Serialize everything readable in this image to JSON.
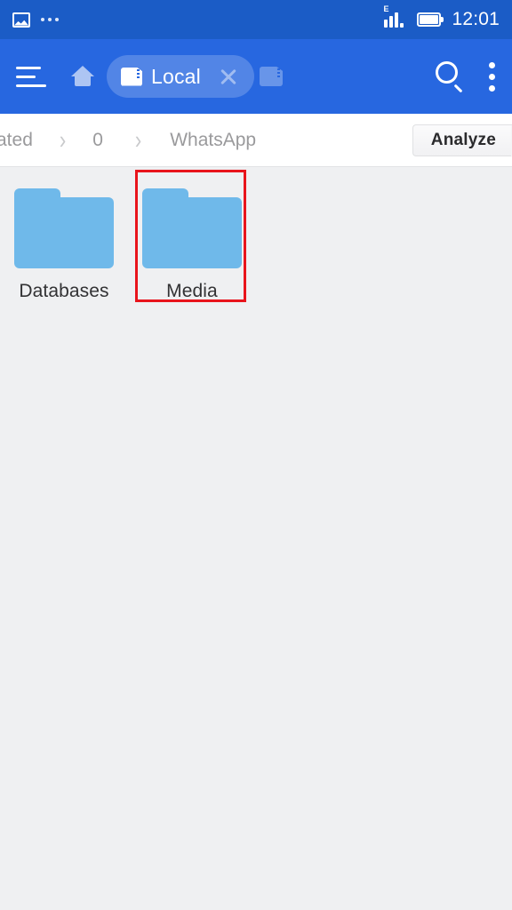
{
  "status_bar": {
    "photo_icon": "image-icon",
    "more_icon": "more-dots-icon",
    "network_type": "E",
    "signal_icon": "signal-bars-icon",
    "battery_icon": "battery-icon",
    "time": "12:01",
    "background_color": "#1b5cc6"
  },
  "app_bar": {
    "menu_icon": "hamburger-menu-icon",
    "home_icon": "home-icon",
    "tab": {
      "storage_icon": "sd-card-icon",
      "label": "Local",
      "close_icon": "close-icon"
    },
    "second_tab_icon": "sd-card-icon",
    "search_icon": "search-icon",
    "overflow_icon": "more-vertical-icon",
    "background_color": "#2767e0"
  },
  "breadcrumb": {
    "items": [
      {
        "label": "ated",
        "truncated": true
      },
      {
        "label": "0",
        "truncated": false
      },
      {
        "label": "WhatsApp",
        "truncated": false
      }
    ],
    "separator": "›",
    "analyze_label": "Analyze"
  },
  "content": {
    "items": [
      {
        "name": "Databases",
        "type": "folder",
        "icon": "folder-icon",
        "highlighted": false
      },
      {
        "name": "Media",
        "type": "folder",
        "icon": "folder-icon",
        "highlighted": true
      }
    ],
    "folder_color": "#6fb9ea",
    "background_color": "#eff0f2",
    "highlight_color": "#e8141c"
  }
}
